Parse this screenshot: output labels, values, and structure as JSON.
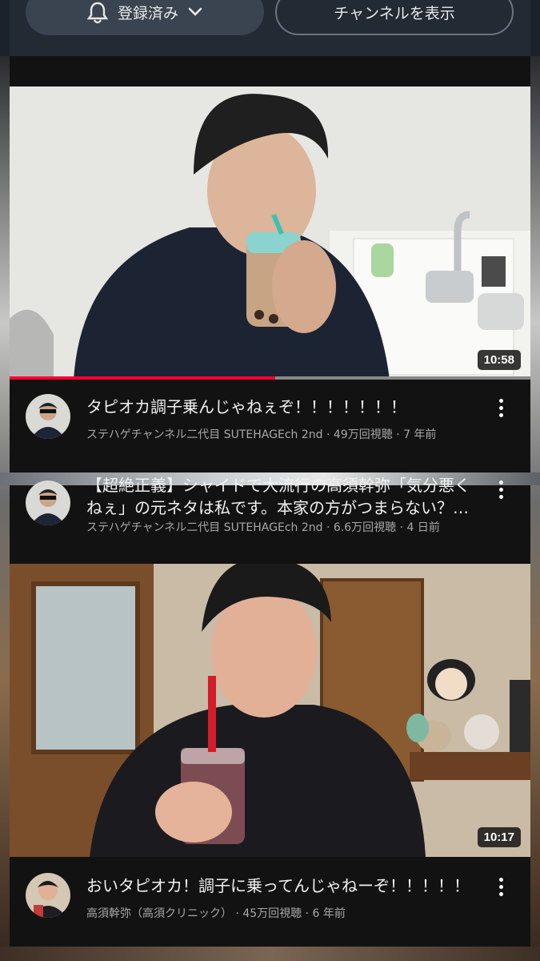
{
  "channel_actions": {
    "subscribed_label": "登録済み",
    "view_channel_label": "チャンネルを表示"
  },
  "videos": [
    {
      "title": "タピオカ調子乗んじゃねぇぞ！！！！！！！",
      "channel": "ステハゲチャンネル二代目 SUTEHAGEch 2nd",
      "views": "49万回視聴",
      "age": "7 年前",
      "duration": "10:58",
      "progress": 0.51
    },
    {
      "title": "【超絶正義】シャイドで大流行の高須幹弥「気分悪くねぇ」の元ネタは私です。本家の方がつまらない？…",
      "channel": "ステハゲチャンネル二代目 SUTEHAGEch 2nd",
      "views": "6.6万回視聴",
      "age": "4 日前"
    },
    {
      "title": "おいタピオカ！調子に乗ってんじゃねーぞ！！！！！",
      "channel": "高須幹弥（高須クリニック）",
      "views": "45万回視聴",
      "age": "6 年前",
      "duration": "10:17"
    }
  ],
  "separator": "·",
  "colors": {
    "progress": "#ff0033",
    "background": "#121212",
    "text": "#f1f1f1",
    "subtext": "#a8a8a8"
  }
}
